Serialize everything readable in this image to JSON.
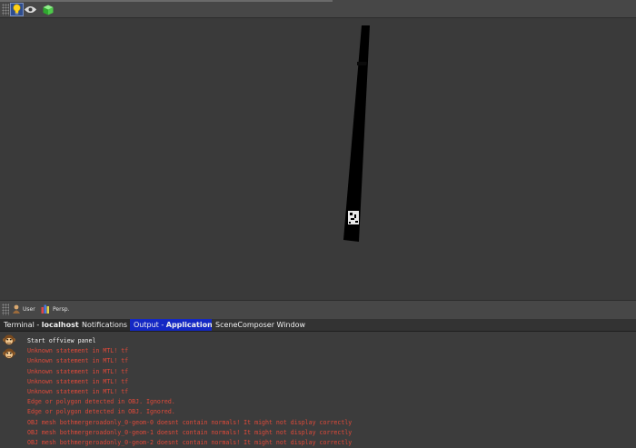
{
  "colors": {
    "accent_tab": "#1428c4",
    "warn_text": "#e04a3a",
    "info_text": "#f0f0f0"
  },
  "toolbar": {
    "icons": [
      "lightbulb-icon",
      "eye-icon",
      "cube-icon"
    ]
  },
  "viewport_bar": {
    "user_label": "User",
    "persp_label": "Persp."
  },
  "tabs": [
    {
      "prefix": "Terminal - ",
      "bold": "localhost"
    },
    {
      "prefix": "Notifications",
      "bold": ""
    },
    {
      "prefix": "Output - ",
      "bold": "Application"
    },
    {
      "prefix": "SceneComposer Window",
      "bold": ""
    }
  ],
  "console": {
    "lines": [
      {
        "level": "info",
        "text": "Start offview panel"
      },
      {
        "level": "warn",
        "text": "Unknown statement in MTL! tf"
      },
      {
        "level": "warn",
        "text": "Unknown statement in MTL! tf"
      },
      {
        "level": "warn",
        "text": "Unknown statement in MTL! tf"
      },
      {
        "level": "warn",
        "text": "Unknown statement in MTL! tf"
      },
      {
        "level": "warn",
        "text": "Unknown statement in MTL! tf"
      },
      {
        "level": "warn",
        "text": "Edge or polygon detected in OBJ. Ignored."
      },
      {
        "level": "warn",
        "text": "Edge or polygon detected in OBJ. Ignored."
      },
      {
        "level": "warn",
        "text": "OBJ mesh bothmergeroadonly_0-geom-0 doesnt contain normals! It might not display correctly"
      },
      {
        "level": "warn",
        "text": "OBJ mesh bothmergeroadonly_0-geom-1 doesnt contain normals! It might not display correctly"
      },
      {
        "level": "warn",
        "text": "OBJ mesh bothmergeroadonly_0-geom-2 doesnt contain normals! It might not display correctly"
      }
    ]
  }
}
